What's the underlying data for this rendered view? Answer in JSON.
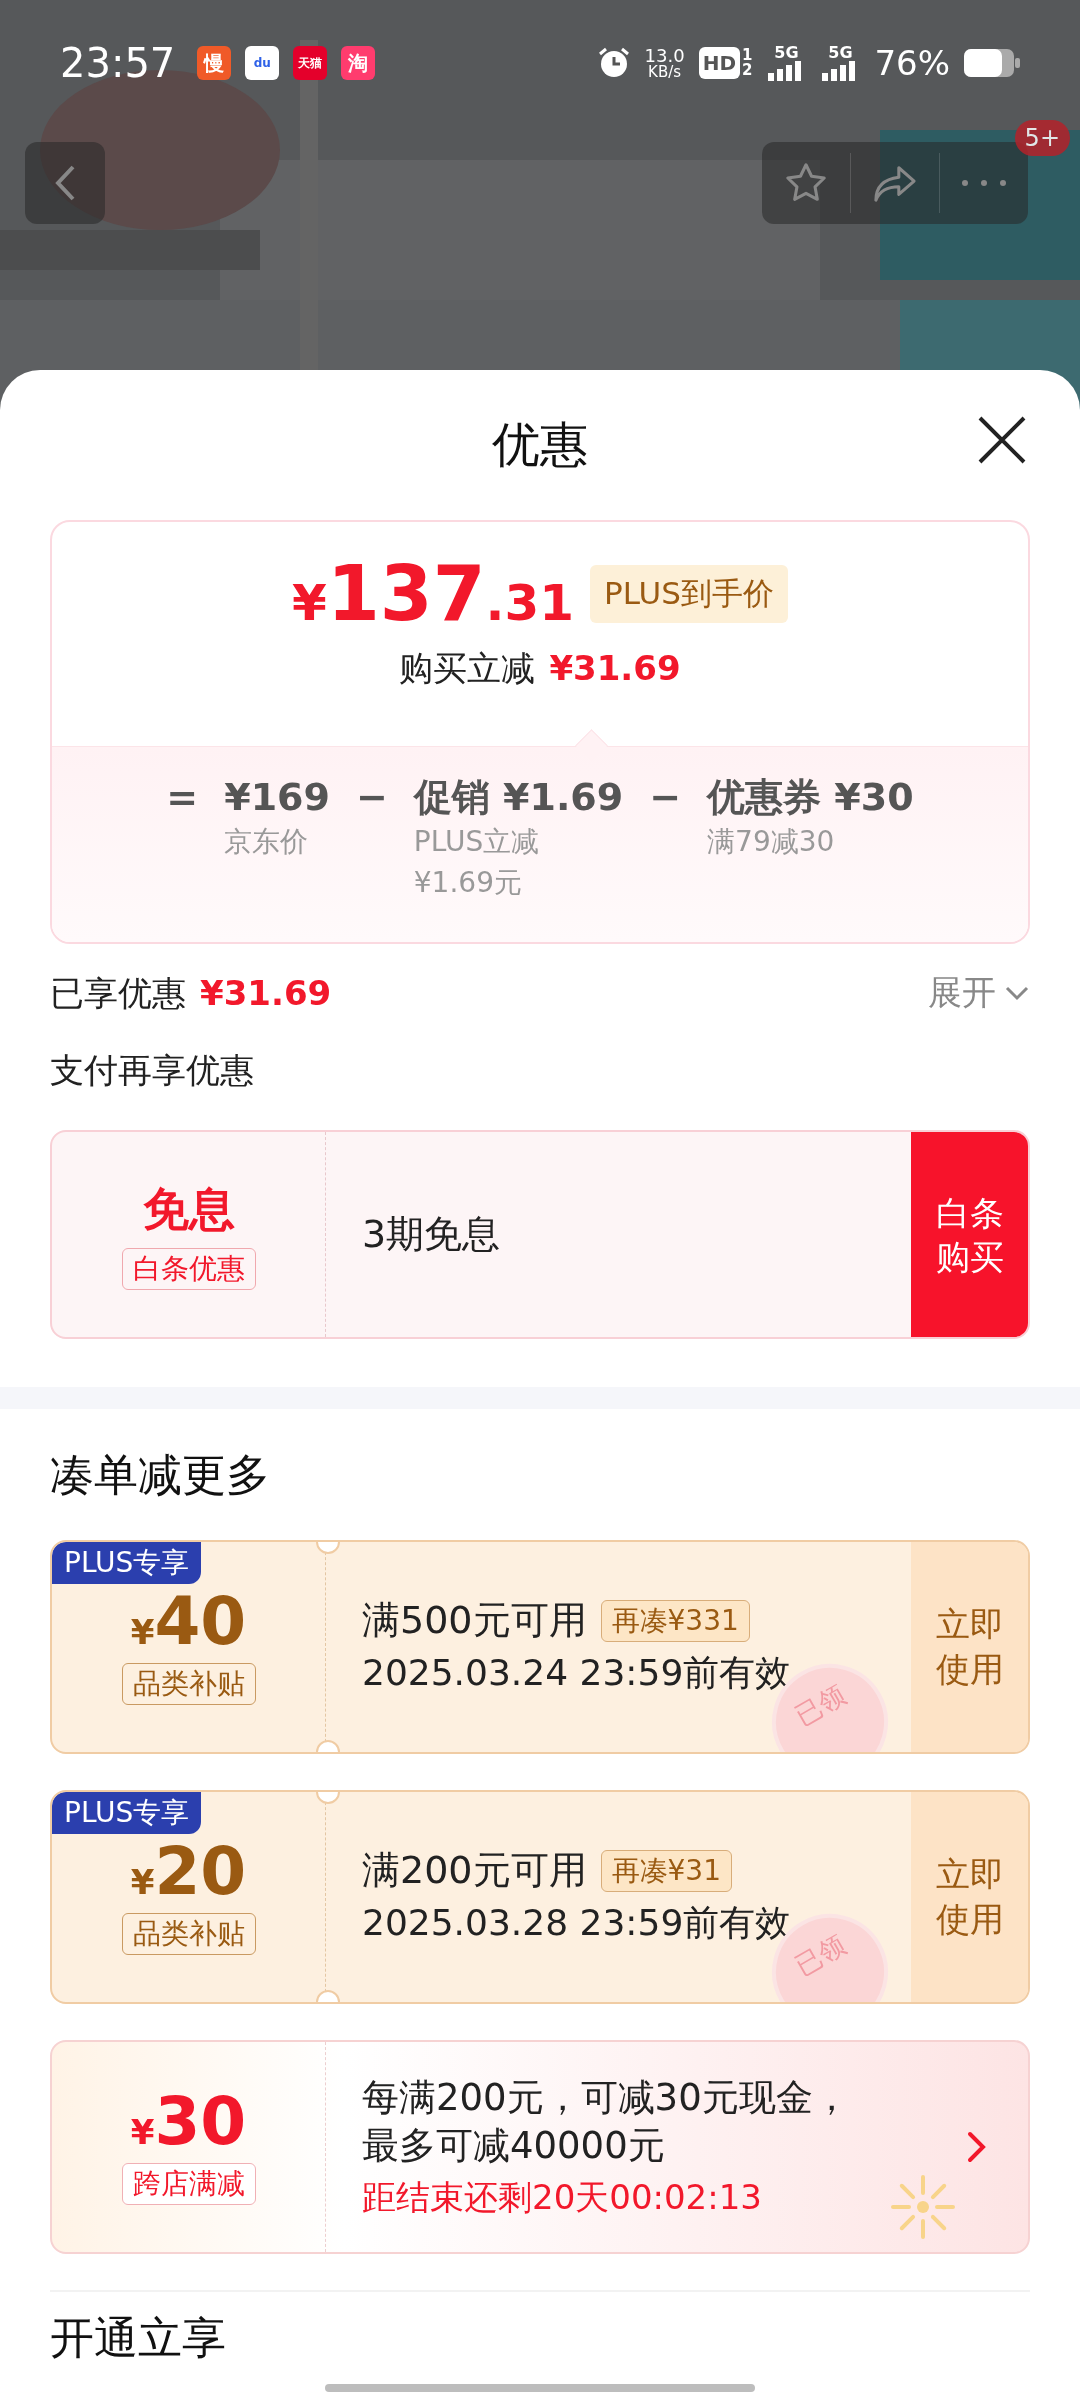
{
  "status_bar": {
    "time": "23:57",
    "notifications": [
      {
        "label": "慢",
        "color": "#f05a28"
      },
      {
        "label": "du",
        "color": "#ffffff"
      },
      {
        "label": "天猫",
        "color": "#e4002b"
      },
      {
        "label": "淘",
        "color": "#ff3c6e"
      }
    ],
    "speed": "13.0",
    "speed_unit": "KB/s",
    "hd": "HD",
    "sims": [
      "1",
      "2"
    ],
    "networks": [
      "5G",
      "5G"
    ],
    "battery": "76%"
  },
  "top_bar": {
    "badge": "5+"
  },
  "sheet": {
    "title": "优惠",
    "price_card": {
      "currency": "¥",
      "integer": "137",
      "decimal": ".31",
      "tag": "PLUS到手价",
      "saving_label": "购买立减",
      "saving_amount": "¥31.69",
      "breakdown": [
        {
          "operator": "=",
          "main": "¥169",
          "notes": [
            "京东价"
          ]
        },
        {
          "operator": "−",
          "main": "促销 ¥1.69",
          "notes": [
            "PLUS立减",
            "¥1.69元"
          ]
        },
        {
          "operator": "−",
          "main": "优惠券 ¥30",
          "notes": [
            "满79减30"
          ]
        }
      ]
    },
    "enjoyed": {
      "label": "已享优惠",
      "amount": "¥31.69",
      "toggle": "展开",
      "expanded": false
    },
    "payment": {
      "heading": "支付再享优惠",
      "title": "免息",
      "tag": "白条优惠",
      "description": "3期免息",
      "button": "白条购买"
    },
    "coupons": {
      "heading": "凑单减更多",
      "items": [
        {
          "kind": "plus",
          "badge": "PLUS专享",
          "currency": "¥",
          "amount": "40",
          "tag": "品类补贴",
          "condition": "满500元可用",
          "gap": "再凑¥331",
          "validity": "2025.03.24 23:59前有效",
          "action": "立即使用",
          "stamp": "已领"
        },
        {
          "kind": "plus",
          "badge": "PLUS专享",
          "currency": "¥",
          "amount": "20",
          "tag": "品类补贴",
          "condition": "满200元可用",
          "gap": "再凑¥31",
          "validity": "2025.03.28 23:59前有效",
          "action": "立即使用",
          "stamp": "已领"
        },
        {
          "kind": "promo",
          "currency": "¥",
          "amount": "30",
          "tag": "跨店满减",
          "description": "每满200元，可减30元现金，最多可减40000元",
          "countdown": "距结束还剩20天00:02:13"
        }
      ]
    },
    "next_heading": "开通立享"
  }
}
